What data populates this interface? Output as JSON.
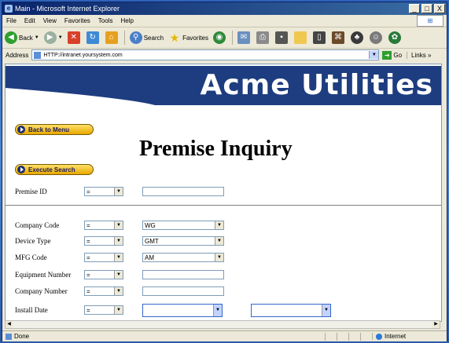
{
  "window": {
    "title": "Main - Microsoft Internet Explorer",
    "minimize": "_",
    "maximize": "□",
    "close": "X"
  },
  "menu": [
    "File",
    "Edit",
    "View",
    "Favorites",
    "Tools",
    "Help"
  ],
  "toolbar": {
    "back": "Back",
    "search": "Search",
    "favorites": "Favorites"
  },
  "address": {
    "label": "Address",
    "value": "HTTP://intranet.yoursystem.com",
    "go": "Go",
    "links": "Links"
  },
  "page": {
    "brand": "Acme Utilities",
    "back_to_menu": "Back to Menu",
    "title": "Premise Inquiry",
    "execute_search": "Execute Search"
  },
  "form": {
    "premise_id": {
      "label": "Premise ID",
      "operator": "=",
      "value": ""
    },
    "company_code": {
      "label": "Company Code",
      "operator": "=",
      "value": "WG"
    },
    "device_type": {
      "label": "Device Type",
      "operator": "=",
      "value": "GMT"
    },
    "mfg_code": {
      "label": "MFG Code",
      "operator": "=",
      "value": "AM"
    },
    "equipment_number": {
      "label": "Equipment Number",
      "operator": "=",
      "value": ""
    },
    "company_number": {
      "label": "Company Number",
      "operator": "=",
      "value": ""
    },
    "install_date": {
      "label": "Install Date",
      "operator": "=",
      "from": "",
      "to": ""
    }
  },
  "status": {
    "text": "Done",
    "zone": "Internet"
  }
}
